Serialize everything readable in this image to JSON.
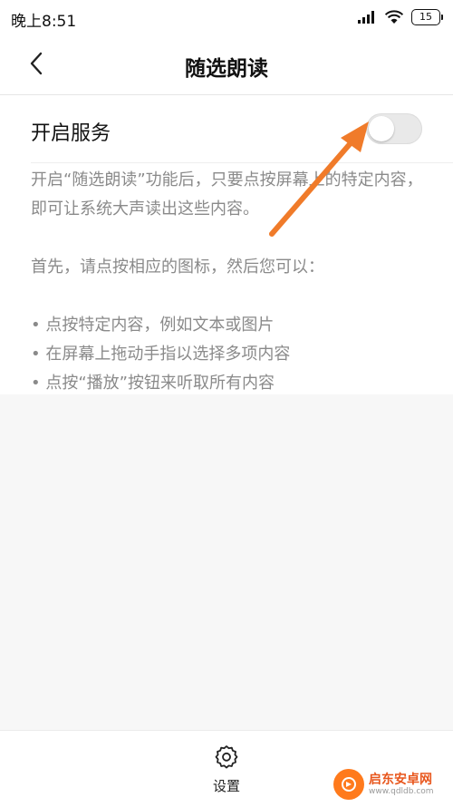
{
  "status_bar": {
    "time": "晚上8:51",
    "battery": "15"
  },
  "header": {
    "title": "随选朗读",
    "back_icon": "chevron-left-icon"
  },
  "service": {
    "label": "开启服务",
    "enabled": false
  },
  "description": {
    "intro": "开启“随选朗读”功能后，只要点按屏幕上的特定内容，即可让系统大声读出这些内容。",
    "lead": "首先，请点按相应的图标，然后您可以：",
    "bullets": [
      "• 点按特定内容，例如文本或图片",
      "• 在屏幕上拖动手指以选择多项内容",
      "• 点按“播放”按钮来听取所有内容"
    ]
  },
  "bottom_nav": {
    "settings_label": "设置",
    "settings_icon": "gear-icon"
  },
  "watermark": {
    "name": "启东安卓网",
    "url": "www.qdldb.com"
  },
  "colors": {
    "arrow": "#f07b2a",
    "accent_watermark": "#ff7a1c"
  }
}
